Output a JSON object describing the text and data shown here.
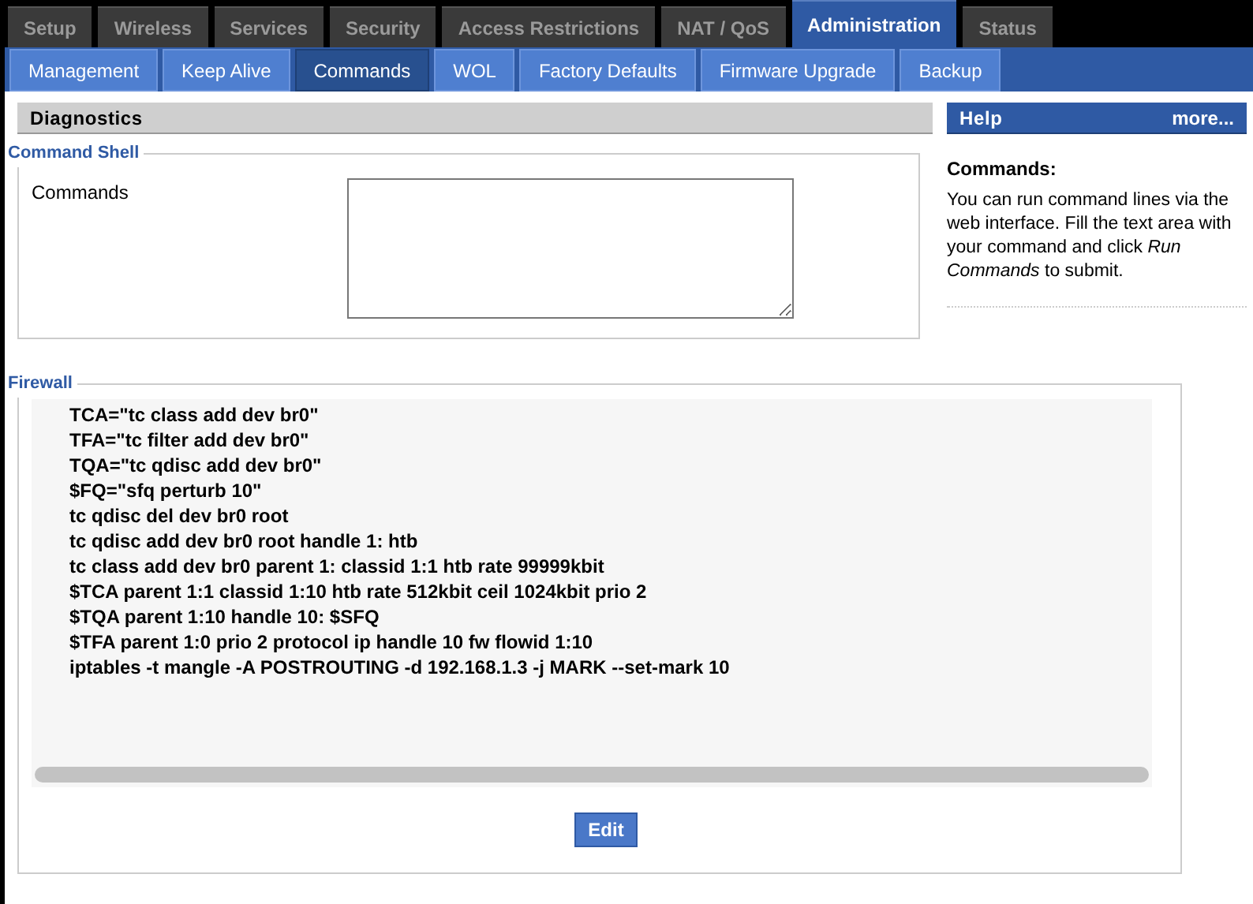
{
  "main_tabs": [
    {
      "label": "Setup",
      "selected": false
    },
    {
      "label": "Wireless",
      "selected": false
    },
    {
      "label": "Services",
      "selected": false
    },
    {
      "label": "Security",
      "selected": false
    },
    {
      "label": "Access Restrictions",
      "selected": false
    },
    {
      "label": "NAT / QoS",
      "selected": false
    },
    {
      "label": "Administration",
      "selected": true
    },
    {
      "label": "Status",
      "selected": false
    }
  ],
  "sub_tabs": [
    {
      "label": "Management",
      "selected": false
    },
    {
      "label": "Keep Alive",
      "selected": false
    },
    {
      "label": "Commands",
      "selected": true
    },
    {
      "label": "WOL",
      "selected": false
    },
    {
      "label": "Factory Defaults",
      "selected": false
    },
    {
      "label": "Firmware Upgrade",
      "selected": false
    },
    {
      "label": "Backup",
      "selected": false
    }
  ],
  "section_title": "Diagnostics",
  "command_shell": {
    "legend": "Command Shell",
    "label": "Commands"
  },
  "firewall": {
    "legend": "Firewall",
    "lines": [
      "TCA=\"tc class add dev br0\"",
      "TFA=\"tc filter add dev br0\"",
      "TQA=\"tc qdisc add dev br0\"",
      "$FQ=\"sfq perturb 10\"",
      "tc qdisc del dev br0 root",
      "tc qdisc add dev br0 root handle 1: htb",
      "tc class add dev br0 parent 1: classid 1:1 htb rate 99999kbit",
      "$TCA parent 1:1 classid 1:10 htb rate 512kbit ceil 1024kbit prio 2",
      "$TQA parent 1:10 handle 10: $SFQ",
      "$TFA parent 1:0 prio 2 protocol ip handle 10 fw flowid 1:10",
      "iptables -t mangle -A POSTROUTING -d 192.168.1.3 -j MARK --set-mark 10"
    ],
    "button": "Edit"
  },
  "help": {
    "title": "Help",
    "more": "more...",
    "heading": "Commands:",
    "text": "You can run command lines via the web interface. Fill the text area with your command and click *Run Commands* to submit."
  }
}
